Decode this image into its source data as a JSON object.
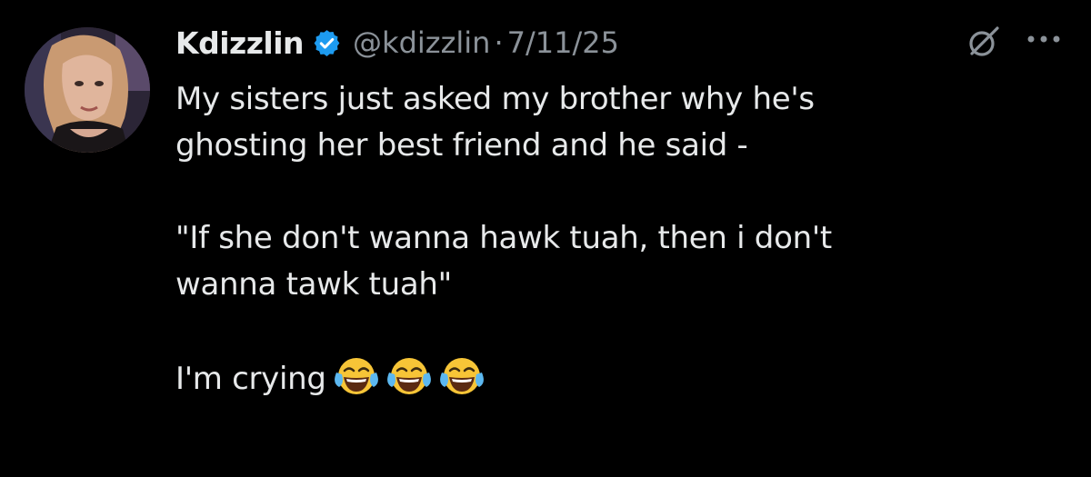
{
  "author": {
    "display_name": "Kdizzlin",
    "handle": "@kdizzlin",
    "separator": "·",
    "date": "7/11/25",
    "verified": true,
    "verified_color": "#1d9bf0"
  },
  "tweet": {
    "lines": [
      "My sisters just asked my brother why he's",
      "ghosting her best friend and he said -",
      "\"If she don't wanna hawk tuah, then i don't",
      "wanna tawk tuah\"",
      "I'm crying"
    ],
    "emoji": [
      "face-with-tears-of-joy",
      "face-with-tears-of-joy",
      "face-with-tears-of-joy"
    ]
  },
  "icons": {
    "verified": "verified-badge-icon",
    "grok": "grok-icon",
    "more": "more-options-icon"
  },
  "colors": {
    "background": "#000000",
    "text": "#e7e9ea",
    "secondary": "#8b9299",
    "accent": "#1d9bf0"
  }
}
